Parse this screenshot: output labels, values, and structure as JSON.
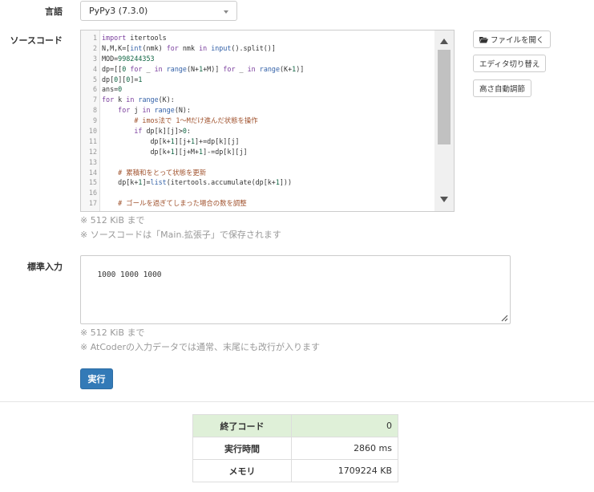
{
  "language": {
    "label": "言語",
    "selected": "PyPy3 (7.3.0)"
  },
  "source": {
    "label": "ソースコード",
    "lines": [
      [
        {
          "t": "import",
          "c": "kw"
        },
        {
          "t": " itertools",
          "c": ""
        }
      ],
      [
        {
          "t": "N,M,K=[",
          "c": ""
        },
        {
          "t": "int",
          "c": "bi"
        },
        {
          "t": "(nmk) ",
          "c": ""
        },
        {
          "t": "for",
          "c": "kw"
        },
        {
          "t": " nmk ",
          "c": ""
        },
        {
          "t": "in",
          "c": "kw"
        },
        {
          "t": " ",
          "c": ""
        },
        {
          "t": "input",
          "c": "bi"
        },
        {
          "t": "().split()]",
          "c": ""
        }
      ],
      [
        {
          "t": "MOD=",
          "c": ""
        },
        {
          "t": "998244353",
          "c": "num"
        }
      ],
      [
        {
          "t": "dp=[[",
          "c": ""
        },
        {
          "t": "0",
          "c": "num"
        },
        {
          "t": " ",
          "c": ""
        },
        {
          "t": "for",
          "c": "kw"
        },
        {
          "t": " _ ",
          "c": ""
        },
        {
          "t": "in",
          "c": "kw"
        },
        {
          "t": " ",
          "c": ""
        },
        {
          "t": "range",
          "c": "bi"
        },
        {
          "t": "(N+",
          "c": ""
        },
        {
          "t": "1",
          "c": "num"
        },
        {
          "t": "+M)] ",
          "c": ""
        },
        {
          "t": "for",
          "c": "kw"
        },
        {
          "t": " _ ",
          "c": ""
        },
        {
          "t": "in",
          "c": "kw"
        },
        {
          "t": " ",
          "c": ""
        },
        {
          "t": "range",
          "c": "bi"
        },
        {
          "t": "(K+",
          "c": ""
        },
        {
          "t": "1",
          "c": "num"
        },
        {
          "t": ")]",
          "c": ""
        }
      ],
      [
        {
          "t": "dp[",
          "c": ""
        },
        {
          "t": "0",
          "c": "num"
        },
        {
          "t": "][",
          "c": ""
        },
        {
          "t": "0",
          "c": "num"
        },
        {
          "t": "]=",
          "c": ""
        },
        {
          "t": "1",
          "c": "num"
        }
      ],
      [
        {
          "t": "ans=",
          "c": ""
        },
        {
          "t": "0",
          "c": "num"
        }
      ],
      [
        {
          "t": "for",
          "c": "kw"
        },
        {
          "t": " k ",
          "c": ""
        },
        {
          "t": "in",
          "c": "kw"
        },
        {
          "t": " ",
          "c": ""
        },
        {
          "t": "range",
          "c": "bi"
        },
        {
          "t": "(K):",
          "c": ""
        }
      ],
      [
        {
          "t": "    ",
          "c": ""
        },
        {
          "t": "for",
          "c": "kw"
        },
        {
          "t": " j ",
          "c": ""
        },
        {
          "t": "in",
          "c": "kw"
        },
        {
          "t": " ",
          "c": ""
        },
        {
          "t": "range",
          "c": "bi"
        },
        {
          "t": "(N):",
          "c": ""
        }
      ],
      [
        {
          "t": "        # imos法で 1～Mだけ進んだ状態を操作",
          "c": "cmt"
        }
      ],
      [
        {
          "t": "        ",
          "c": ""
        },
        {
          "t": "if",
          "c": "kw"
        },
        {
          "t": " dp[k][j]>",
          "c": ""
        },
        {
          "t": "0",
          "c": "num"
        },
        {
          "t": ":",
          "c": ""
        }
      ],
      [
        {
          "t": "            dp[k+",
          "c": ""
        },
        {
          "t": "1",
          "c": "num"
        },
        {
          "t": "][j+",
          "c": ""
        },
        {
          "t": "1",
          "c": "num"
        },
        {
          "t": "]+=dp[k][j]",
          "c": ""
        }
      ],
      [
        {
          "t": "            dp[k+",
          "c": ""
        },
        {
          "t": "1",
          "c": "num"
        },
        {
          "t": "][j+M+",
          "c": ""
        },
        {
          "t": "1",
          "c": "num"
        },
        {
          "t": "]-=dp[k][j]",
          "c": ""
        }
      ],
      [
        {
          "t": "",
          "c": ""
        }
      ],
      [
        {
          "t": "    # 累積和をとって状態を更新",
          "c": "cmt"
        }
      ],
      [
        {
          "t": "    dp[k+",
          "c": ""
        },
        {
          "t": "1",
          "c": "num"
        },
        {
          "t": "]=",
          "c": ""
        },
        {
          "t": "list",
          "c": "bi"
        },
        {
          "t": "(itertools.accumulate(dp[k+",
          "c": ""
        },
        {
          "t": "1",
          "c": "num"
        },
        {
          "t": "]))",
          "c": ""
        }
      ],
      [
        {
          "t": "",
          "c": ""
        }
      ],
      [
        {
          "t": "    # ゴールを過ぎてしまった場合の数を調整",
          "c": "cmt"
        }
      ]
    ],
    "notes": [
      "※ 512 KiB まで",
      "※ ソースコードは「Main.拡張子」で保存されます"
    ]
  },
  "side_buttons": {
    "open_file": "ファイルを開く",
    "editor_toggle": "エディタ切り替え",
    "auto_height": "高さ自動調節"
  },
  "stdin": {
    "label": "標準入力",
    "value": "1000 1000 1000",
    "notes": [
      "※ 512 KiB まで",
      "※ AtCoderの入力データでは通常、末尾にも改行が入ります"
    ]
  },
  "run_button": "実行",
  "result": [
    {
      "key": "終了コード",
      "value": "0"
    },
    {
      "key": "実行時間",
      "value": "2860 ms"
    },
    {
      "key": "メモリ",
      "value": "1709224 KB"
    }
  ]
}
